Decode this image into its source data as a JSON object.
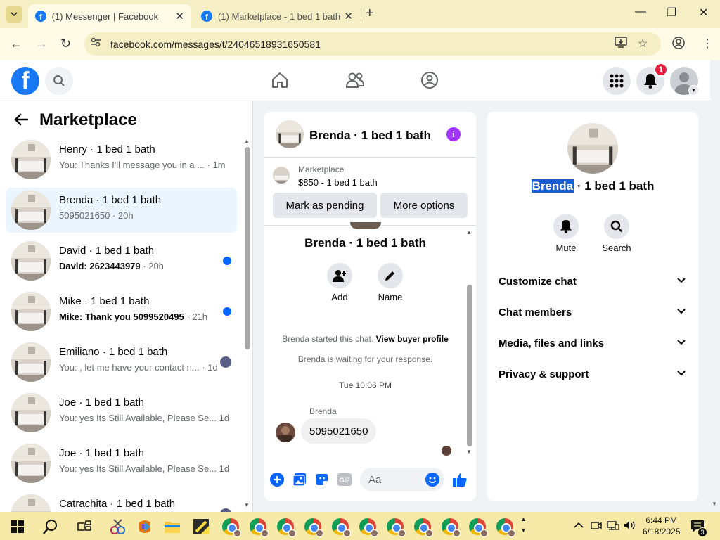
{
  "browser": {
    "tabs": [
      {
        "title": "(1) Messenger | Facebook",
        "active": true
      },
      {
        "title": "(1) Marketplace - 1 bed 1 bath",
        "active": false
      }
    ],
    "url": "facebook.com/messages/t/24046518931650581"
  },
  "facebook": {
    "notifications_badge": "1"
  },
  "left_panel": {
    "title": "Marketplace",
    "conversations": [
      {
        "name": "Henry · 1 bed 1 bath",
        "snippet": "You: Thanks I'll message you in a ...",
        "time": " · 1m",
        "unread": false,
        "selected": false,
        "indicator": "none"
      },
      {
        "name": "Brenda · 1 bed 1 bath",
        "snippet": "5095021650",
        "time": " · 20h",
        "unread": false,
        "selected": true,
        "indicator": "none"
      },
      {
        "name": "David · 1 bed 1 bath",
        "snippet": "David: 2623443979",
        "time": " · 20h",
        "unread": true,
        "selected": false,
        "indicator": "dot"
      },
      {
        "name": "Mike · 1 bed 1 bath",
        "snippet": "Mike: Thank you 5099520495",
        "time": " · 21h",
        "unread": true,
        "selected": false,
        "indicator": "dot"
      },
      {
        "name": "Emiliano · 1 bed 1 bath",
        "snippet": "You: , let me have your contact n...",
        "time": " · 1d",
        "unread": false,
        "selected": false,
        "indicator": "seen"
      },
      {
        "name": "Joe · 1 bed 1 bath",
        "snippet": "You: yes Its Still Available, Please Se...",
        "time": " 1d",
        "unread": false,
        "selected": false,
        "indicator": "none"
      },
      {
        "name": "Joe · 1 bed 1 bath",
        "snippet": "You: yes Its Still Available, Please Se...",
        "time": " 1d",
        "unread": false,
        "selected": false,
        "indicator": "none"
      },
      {
        "name": "Catrachita · 1 bed 1 bath",
        "snippet": "",
        "time": "",
        "unread": false,
        "selected": false,
        "indicator": "seen"
      }
    ]
  },
  "chat": {
    "header_name": "Brenda · 1 bed 1 bath",
    "listing_label": "Marketplace",
    "listing_price": "$850 - 1 bed 1 bath",
    "mark_pending_label": "Mark as pending",
    "more_options_label": "More options",
    "thread_name": "Brenda · 1 bed 1 bath",
    "add_label": "Add",
    "name_label": "Name",
    "started_text": "Brenda started this chat. ",
    "view_profile_link": "View buyer profile",
    "waiting_text": "Brenda is waiting for your response.",
    "timestamp": "Tue 10:06 PM",
    "message_sender": "Brenda",
    "message_text": "5095021650",
    "composer_placeholder": "Aa"
  },
  "details": {
    "name_highlight": "Brenda",
    "name_rest": " · 1 bed 1 bath",
    "mute_label": "Mute",
    "search_label": "Search",
    "sections": [
      "Customize chat",
      "Chat members",
      "Media, files and links",
      "Privacy & support"
    ]
  },
  "taskbar": {
    "time": "6:44 PM",
    "date": "6/18/2025",
    "notification_count": "3"
  },
  "colors": {
    "fb_blue": "#1877f2",
    "messenger_blue": "#0866ff",
    "selected_bg": "#ebf5ff",
    "info_purple": "#a033ff",
    "browser_frame": "#f6eec4",
    "taskbar": "#f7e9a8"
  }
}
